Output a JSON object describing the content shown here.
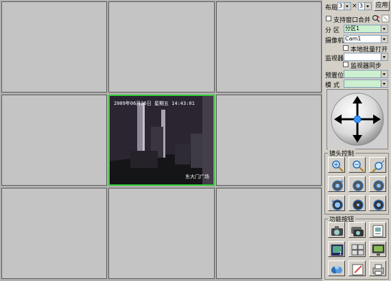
{
  "layout_label": "布局",
  "rows_value": "3",
  "times_sign": "×",
  "cols_value": "3",
  "apply_label": "应用",
  "merge_label": "支持窗口合并",
  "zone_label": "分 区",
  "zone_value": "分区1",
  "camera_label": "摄像机",
  "camera_value": "Cam1",
  "batch_open_label": "本地批量打开",
  "monitor_label": "监视器",
  "monitor_value": "",
  "monitor_sync_label": "监视器同步",
  "preset_label": "预置位",
  "preset_value": "",
  "mode_label": "模 式",
  "mode_value": "",
  "lens_control_title": "镜头控制",
  "function_buttons_title": "功能按钮",
  "video": {
    "timestamp": "2009年06月26日 星期五 14:43:01",
    "location": "东大门广场"
  },
  "colors": {
    "active_border": "#33cc33",
    "ptz_arrow": "#000000",
    "ptz_center": "#3399ff"
  },
  "lens_icons": [
    "zoom-in-icon",
    "zoom-out-icon",
    "zoom-fit-icon",
    "focus-near-icon",
    "focus-icon",
    "focus-far-icon",
    "iris-open-icon",
    "iris-icon",
    "iris-close-icon"
  ],
  "function_icons": [
    "snapshot-icon",
    "multi-snapshot-icon",
    "gallery-icon",
    "single-view-icon",
    "multi-view-icon",
    "monitor-icon",
    "record-search-icon",
    "edit-icon",
    "print-icon"
  ]
}
